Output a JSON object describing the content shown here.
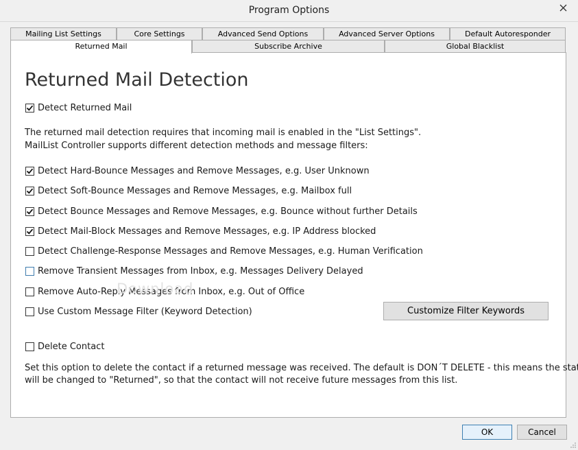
{
  "window": {
    "title": "Program Options",
    "close_glyph": "×"
  },
  "tabs_row_back": [
    {
      "label": "Mailing List Settings"
    },
    {
      "label": "Core Settings"
    },
    {
      "label": "Advanced Send Options"
    },
    {
      "label": "Advanced Server Options"
    },
    {
      "label": "Default Autoresponder"
    }
  ],
  "tabs_row_front": [
    {
      "label": "Returned Mail",
      "active": true
    },
    {
      "label": "Subscribe Archive"
    },
    {
      "label": "Global Blacklist"
    }
  ],
  "panel": {
    "heading": "Returned Mail Detection",
    "detect_returned_mail": {
      "label": "Detect Returned Mail",
      "checked": true
    },
    "description_line1": "The returned mail detection requires that incoming mail is enabled in the \"List Settings\".",
    "description_line2": "MailList Controller supports different detection methods and message filters:",
    "options": [
      {
        "label": "Detect Hard-Bounce Messages and Remove Messages, e.g. User Unknown",
        "checked": true
      },
      {
        "label": "Detect Soft-Bounce Messages and Remove Messages, e.g. Mailbox full",
        "checked": true
      },
      {
        "label": "Detect Bounce Messages and Remove Messages, e.g. Bounce without further Details",
        "checked": true
      },
      {
        "label": "Detect Mail-Block Messages and Remove Messages, e.g. IP Address blocked",
        "checked": true
      },
      {
        "label": "Detect Challenge-Response Messages and Remove Messages, e.g. Human Verification",
        "checked": false
      },
      {
        "label": "Remove Transient Messages from Inbox, e.g. Messages Delivery Delayed",
        "checked": false
      },
      {
        "label": "Remove Auto-Reply Messages from Inbox, e.g. Out of Office",
        "checked": false
      },
      {
        "label": "Use Custom Message Filter (Keyword Detection)",
        "checked": false
      }
    ],
    "customize_button": "Customize Filter Keywords",
    "delete_contact": {
      "label": "Delete Contact",
      "checked": false
    },
    "delete_note_line1": "Set this option to delete the contact if a returned message was received. The default is DON´T DELETE - this means the status",
    "delete_note_line2": "will be changed to \"Returned\", so that the contact will not receive future messages from this list.",
    "watermark": "Download"
  },
  "footer": {
    "ok_label": "OK",
    "cancel_label": "Cancel"
  },
  "colors": {
    "accent": "#3c7fb1",
    "panel_bg": "#ffffff",
    "window_bg": "#f0f0f0"
  }
}
